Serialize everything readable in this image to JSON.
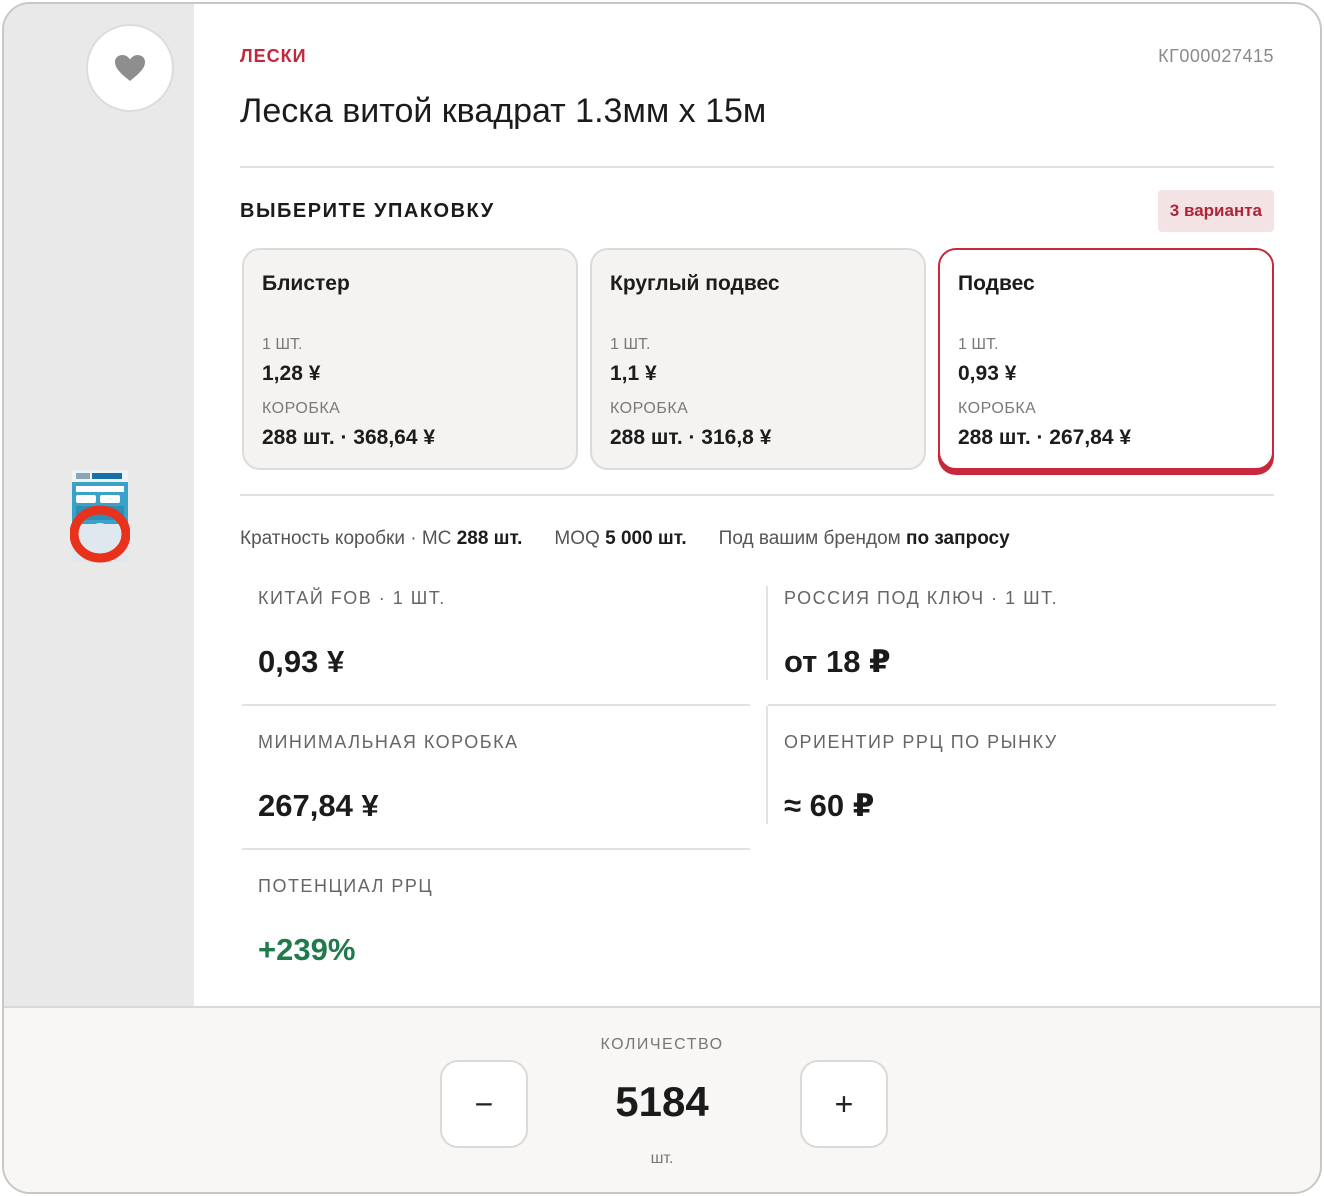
{
  "product": {
    "category": "ЛЕСКИ",
    "sku": "КГ000027415",
    "title": "Леска витой квадрат 1.3мм х 15м"
  },
  "packaging": {
    "heading": "ВЫБЕРИТЕ УПАКОВКУ",
    "variants_badge": "3 варианта",
    "options": [
      {
        "name": "Блистер",
        "unit_label": "1 ШТ.",
        "unit_price": "1,28 ¥",
        "box_label": "КОРОБКА",
        "box_value": "288 шт. · 368,64 ¥",
        "selected": false
      },
      {
        "name": "Круглый подвес",
        "unit_label": "1 ШТ.",
        "unit_price": "1,1 ¥",
        "box_label": "КОРОБКА",
        "box_value": "288 шт. · 316,8 ¥",
        "selected": false
      },
      {
        "name": "Подвес",
        "unit_label": "1 ШТ.",
        "unit_price": "0,93 ¥",
        "box_label": "КОРОБКА",
        "box_value": "288 шт. · 267,84 ¥",
        "selected": true
      }
    ]
  },
  "terms": {
    "box_multiplicity_label": "Кратность коробки · МС",
    "box_multiplicity_value": "288 шт.",
    "moq_label": "MOQ",
    "moq_value": "5 000 шт.",
    "brand_label": "Под вашим брендом",
    "brand_value": "по запросу"
  },
  "metrics": {
    "china_fob": {
      "label": "КИТАЙ FOB · 1 ШТ.",
      "value": "0,93 ¥"
    },
    "russia_turnkey": {
      "label": "РОССИЯ ПОД КЛЮЧ · 1 ШТ.",
      "value": "от 18 ₽"
    },
    "min_box": {
      "label": "МИНИМАЛЬНАЯ КОРОБКА",
      "value": "267,84 ¥"
    },
    "rrp_guide": {
      "label": "ОРИЕНТИР РРЦ ПО РЫНКУ",
      "value": "≈ 60 ₽"
    },
    "rrp_potential": {
      "label": "ПОТЕНЦИАЛ РРЦ",
      "value": "+239%"
    }
  },
  "quantity": {
    "label": "КОЛИЧЕСТВО",
    "value": "5184",
    "unit": "шт.",
    "decrement": "−",
    "increment": "+"
  },
  "colors": {
    "accent": "#c8283b",
    "positive": "#1f7a4c",
    "side_panel": "#e8e9e8"
  },
  "icons": {
    "favorite": "heart-icon"
  }
}
